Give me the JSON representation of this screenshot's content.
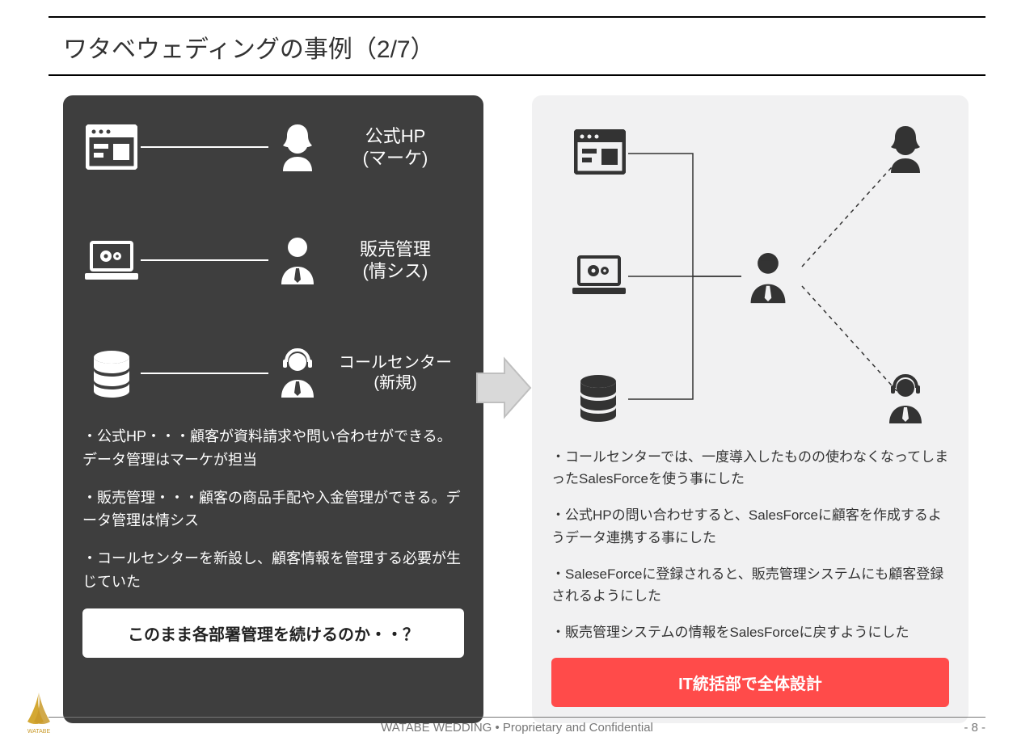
{
  "title": "ワタベウェディングの事例（2/7）",
  "left": {
    "rows": [
      {
        "icon": "browser",
        "person": "person-female",
        "label": "公式HP\n(マーケ)"
      },
      {
        "icon": "laptop",
        "person": "person-tie",
        "label": "販売管理\n(情シス)"
      },
      {
        "icon": "database",
        "person": "person-headset",
        "label": "コールセンター\n(新規)"
      }
    ],
    "bullets": [
      "・公式HP・・・顧客が資料請求や問い合わせができる。データ管理はマーケが担当",
      "・販売管理・・・顧客の商品手配や入金管理ができる。データ管理は情シス",
      "・コールセンターを新設し、顧客情報を管理する必要が生じていた"
    ],
    "cta": "このまま各部署管理を続けるのか・・？"
  },
  "right": {
    "bullets": [
      "・コールセンターでは、一度導入したものの使わなくなってしまったSalesForceを使う事にした",
      "・公式HPの問い合わせすると、SalesForceに顧客を作成するようデータ連携する事にした",
      "・SaleseForceに登録されると、販売管理システムにも顧客登録されるようにした",
      "・販売管理システムの情報をSalesForceに戻すようにした"
    ],
    "cta": "IT統括部で全体設計"
  },
  "footer": {
    "center": "WATABE WEDDING   •   Proprietary and Confidential",
    "page": "- 8 -",
    "brand": "WATABE"
  }
}
